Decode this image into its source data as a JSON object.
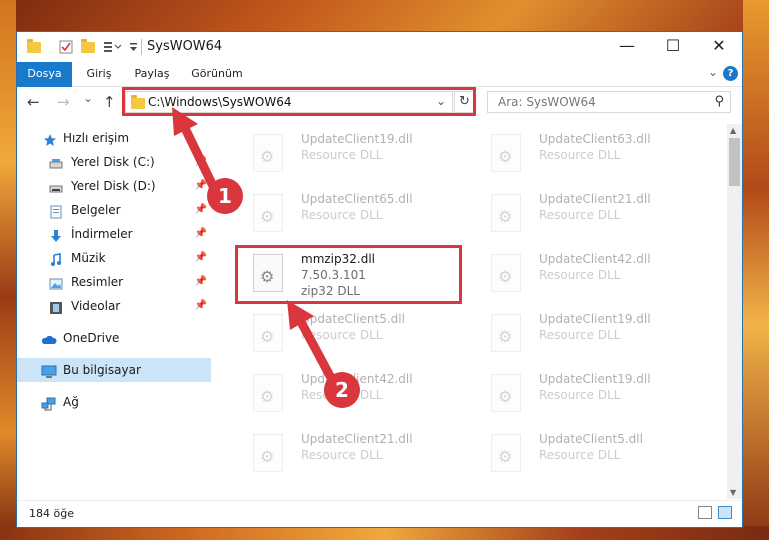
{
  "window": {
    "title": "SysWOW64",
    "minimize_label": "—",
    "maximize_label": "☐",
    "close_label": "✕"
  },
  "ribbon": {
    "tabs": [
      "Dosya",
      "Giriş",
      "Paylaş",
      "Görünüm"
    ],
    "help_label": "?"
  },
  "navigation": {
    "back": "←",
    "forward": "→",
    "recent": "⌄",
    "up": "↑",
    "address": "C:\\Windows\\SysWOW64",
    "refresh": "↻",
    "search_placeholder": "Ara: SysWOW64"
  },
  "sidebar": {
    "items": [
      {
        "label": "Hızlı erişim",
        "icon": "star-icon"
      },
      {
        "label": "Yerel Disk (C:)",
        "icon": "drive-icon"
      },
      {
        "label": "Yerel Disk (D:)",
        "icon": "drive-icon"
      },
      {
        "label": "Belgeler",
        "icon": "documents-icon"
      },
      {
        "label": "İndirmeler",
        "icon": "download-icon"
      },
      {
        "label": "Müzik",
        "icon": "music-icon"
      },
      {
        "label": "Resimler",
        "icon": "pictures-icon"
      },
      {
        "label": "Videolar",
        "icon": "video-icon"
      },
      {
        "label": "OneDrive",
        "icon": "cloud-icon"
      },
      {
        "label": "Bu bilgisayar",
        "icon": "computer-icon"
      },
      {
        "label": "Ağ",
        "icon": "network-icon"
      }
    ]
  },
  "files": {
    "left": [
      {
        "name": "UpdateClient19.dll",
        "desc": "Resource DLL"
      },
      {
        "name": "UpdateClient65.dll",
        "desc": "Resource DLL"
      },
      {
        "name": "mmzip32.dll",
        "version": "7.50.3.101",
        "desc": "zip32 DLL"
      },
      {
        "name": "UpdateClient5.dll",
        "desc": "Resource DLL"
      },
      {
        "name": "UpdateClient42.dll",
        "desc": "Resource DLL"
      },
      {
        "name": "UpdateClient21.dll",
        "desc": "Resource DLL"
      }
    ],
    "right": [
      {
        "name": "UpdateClient63.dll",
        "desc": "Resource DLL"
      },
      {
        "name": "UpdateClient21.dll",
        "desc": "Resource DLL"
      },
      {
        "name": "UpdateClient42.dll",
        "desc": "Resource DLL"
      },
      {
        "name": "UpdateClient19.dll",
        "desc": "Resource DLL"
      },
      {
        "name": "UpdateClient19.dll",
        "desc": "Resource DLL"
      },
      {
        "name": "UpdateClient5.dll",
        "desc": "Resource DLL"
      }
    ]
  },
  "status": {
    "item_count": "184 öğe"
  },
  "callouts": [
    "1",
    "2"
  ],
  "colors": {
    "accent": "#1979ca",
    "highlight": "#d9363e",
    "selected": "#cce4f7"
  }
}
